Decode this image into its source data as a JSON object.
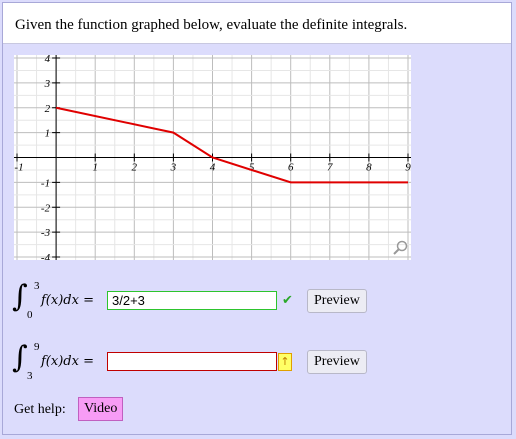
{
  "question": {
    "text": "Given the function graphed below, evaluate the definite integrals."
  },
  "graph": {
    "x_ticks": [
      "-1",
      "1",
      "2",
      "3",
      "4",
      "5",
      "6",
      "7",
      "8",
      "9"
    ],
    "y_ticks": [
      "4",
      "3",
      "2",
      "1",
      "-1",
      "-2",
      "-3",
      "-4"
    ],
    "x_range": [
      -1,
      9
    ],
    "y_range": [
      -4,
      4
    ],
    "line_color": "#e00000",
    "function_points": [
      [
        0,
        2
      ],
      [
        3,
        1
      ],
      [
        4,
        0
      ],
      [
        6,
        -1
      ],
      [
        9,
        -1
      ]
    ],
    "zoom_icon": "magnifier-icon"
  },
  "integrals": [
    {
      "lower": "0",
      "upper": "3",
      "expression": "f(x)dx =",
      "answer": "3/2+3",
      "status": "correct",
      "preview_label": "Preview"
    },
    {
      "lower": "3",
      "upper": "9",
      "expression": "f(x)dx =",
      "answer": "",
      "status": "warning",
      "preview_label": "Preview"
    }
  ],
  "help": {
    "label": "Get help:",
    "video_label": "Video"
  }
}
